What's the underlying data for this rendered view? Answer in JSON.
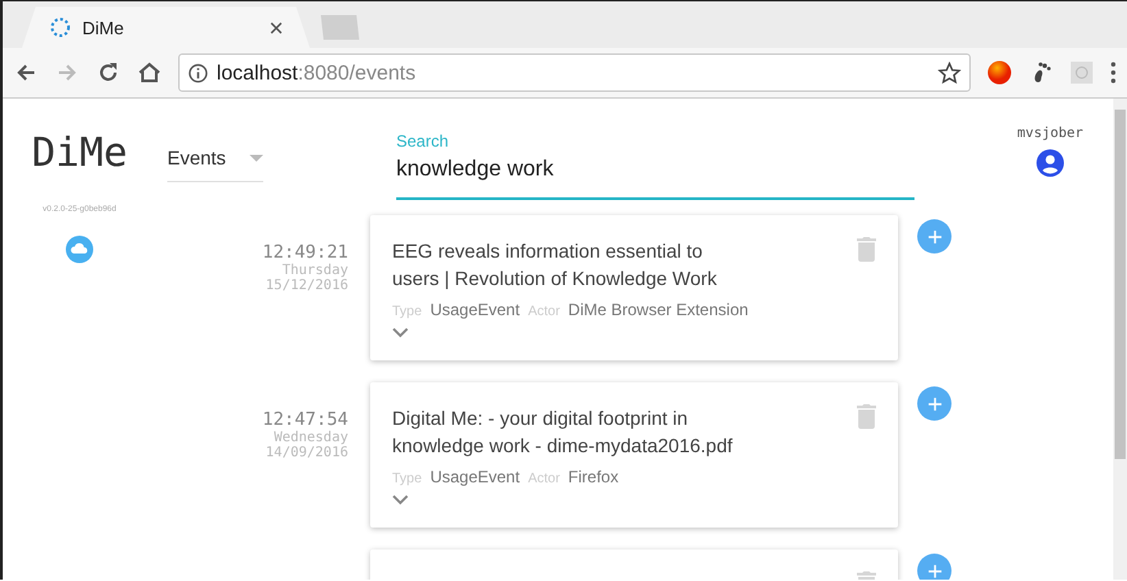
{
  "browser": {
    "tab": {
      "title": "DiMe"
    },
    "url": {
      "host": "localhost",
      "path": ":8080/events"
    }
  },
  "app": {
    "logo": "DiMe",
    "version": "v0.2.0-25-g0beb96d",
    "view_menu": {
      "value": "Events"
    },
    "search": {
      "label": "Search",
      "value": "knowledge work"
    },
    "user": {
      "name": "mvsjober"
    }
  },
  "events": [
    {
      "kind": "full",
      "time": "12:49:21",
      "weekday": "Thursday",
      "date": "15/12/2016",
      "title": "EEG reveals information essential to users | Revolution of Knowledge Work",
      "type_label": "Type",
      "type": "UsageEvent",
      "actor_label": "Actor",
      "actor": "DiMe Browser Extension"
    },
    {
      "kind": "full",
      "time": "12:47:54",
      "weekday": "Wednesday",
      "date": "14/09/2016",
      "title": "Digital Me: - your digital footprint in knowledge work - dime-mydata2016.pdf",
      "type_label": "Type",
      "type": "UsageEvent",
      "actor_label": "Actor",
      "actor": "Firefox"
    },
    {
      "kind": "cut"
    }
  ]
}
